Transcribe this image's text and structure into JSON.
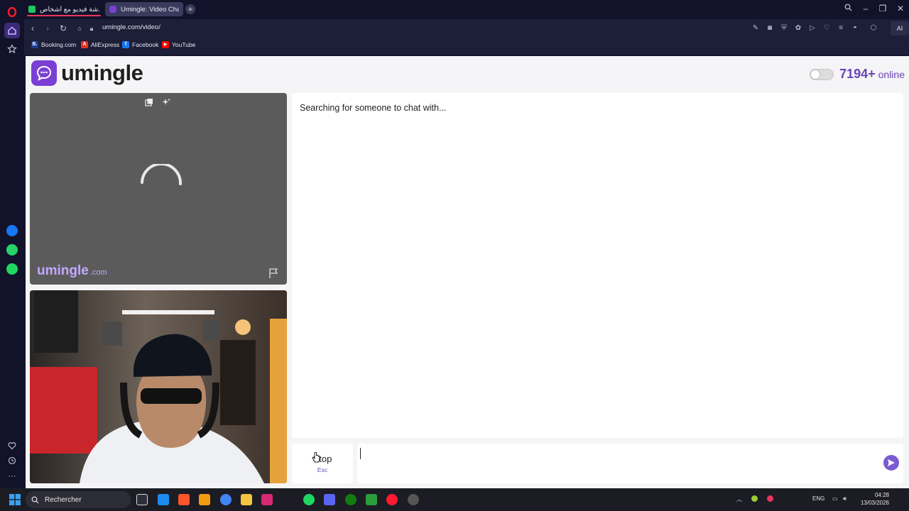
{
  "browser": {
    "tabs": [
      {
        "label": "آزاردردشة فيديو مع أشخاص",
        "active": false
      },
      {
        "label": "Umingle: Video Chat",
        "active": true
      }
    ],
    "address": "umingle.com/video/",
    "ai_label": "AI",
    "bookmarks": [
      {
        "label": "Booking.com",
        "fav": "B.",
        "color": "#1a3d8f"
      },
      {
        "label": "AliExpress",
        "fav": "A",
        "color": "#e43225"
      },
      {
        "label": "Facebook",
        "fav": "f",
        "color": "#1877f2"
      },
      {
        "label": "YouTube",
        "fav": "▶",
        "color": "#ff0000"
      }
    ]
  },
  "site": {
    "logo_text": "umingle",
    "online_count": "7194+",
    "online_label": "online",
    "watermark_name": "umingle",
    "watermark_tld": ".com",
    "status": "Searching for someone to chat with...",
    "stop_label": "Stop",
    "stop_key": "Esc",
    "message_placeholder": ""
  },
  "taskbar": {
    "search_label": "Rechercher",
    "lang": "ENG",
    "time": "04:28",
    "date": "13/03/2026"
  },
  "colors": {
    "brand": "#6b43b8",
    "brand_icon": "#7b3fd6"
  }
}
